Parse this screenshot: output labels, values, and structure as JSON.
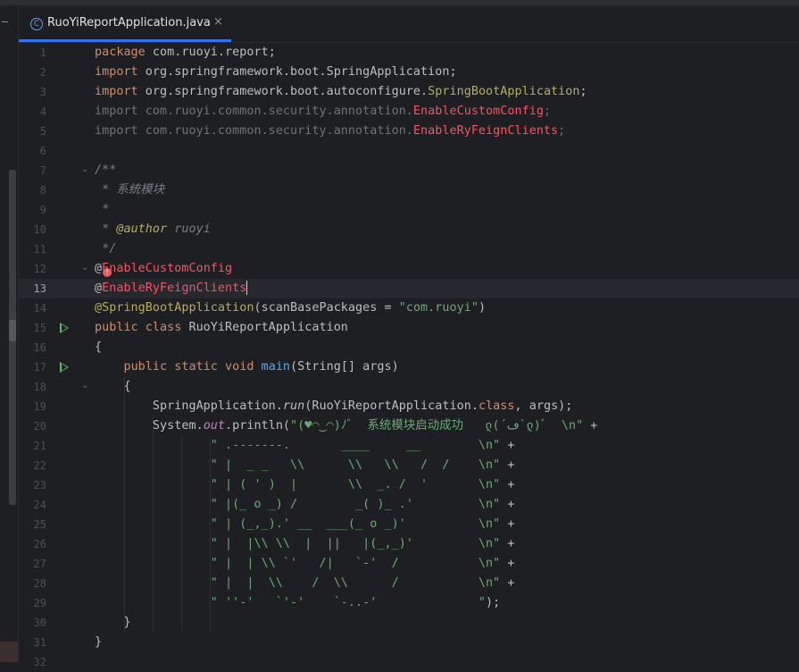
{
  "tab": {
    "icon_name": "java-class-icon",
    "icon_glyph": "C",
    "file_name": "RuoYiReportApplication.java",
    "close_glyph": "×"
  },
  "editor": {
    "current_line": 13,
    "line_numbers": [
      "1",
      "2",
      "3",
      "4",
      "5",
      "6",
      "7",
      "8",
      "9",
      "10",
      "11",
      "12",
      "13",
      "14",
      "15",
      "16",
      "17",
      "18",
      "19",
      "20",
      "21",
      "22",
      "23",
      "24",
      "25",
      "26",
      "27",
      "28",
      "29",
      "30",
      "31",
      "32"
    ]
  },
  "code": {
    "l1": {
      "kw": "package",
      "rest": " com.ruoyi.report;"
    },
    "l2": {
      "kw": "import",
      "rest": " org.springframework.boot.SpringApplication;"
    },
    "l3": {
      "kw": "import",
      "rest": " org.springframework.boot.autoconfigure.",
      "cls": "SpringBootApplication",
      "end": ";"
    },
    "l4": {
      "pre": "import com.ruoyi.common.security.annotation.",
      "err": "EnableCustomConfig",
      "end": ";"
    },
    "l5": {
      "pre": "import com.ruoyi.common.security.annotation.",
      "err": "EnableRyFeignClients",
      "end": ";"
    },
    "l7": "/**",
    "l8": " * 系统模块",
    "l9": " *",
    "l10": {
      "pre": " * ",
      "tag": "@author",
      "rest": " ruoyi"
    },
    "l11": " */",
    "l12": {
      "at": "@",
      "err": "EnableCustomConfig"
    },
    "l13": {
      "at": "@",
      "err": "EnableRyFeignClients"
    },
    "l14": {
      "ann": "@SpringBootApplication",
      "open": "(scanBasePackages = ",
      "str": "\"com.ruoyi\"",
      "close": ")"
    },
    "l15": {
      "kw": "public class",
      "rest": " RuoYiReportApplication"
    },
    "l16": "{",
    "l17": {
      "indent": "    ",
      "kw": "public static void",
      "sp": " ",
      "fn": "main",
      "rest": "(String[] args)"
    },
    "l18": "    {",
    "l19": {
      "indent": "        SpringApplication.",
      "stat": "run",
      "mid": "(RuoYiReportApplication.",
      "kw": "class",
      "rest": ", args);"
    },
    "l20": {
      "indent": "        System.",
      "stat": "out",
      "mid": ".println(",
      "str": "\"(♥◠‿◠)ﾉﾞ  系统模块启动成功   ლ(´ڡ`ლ)ﾞ  \\n\"",
      "rest": " +"
    },
    "l21": {
      "indent": "                ",
      "str": "\" .-------.       ____     __        \\n\"",
      "rest": " +"
    },
    "l22": {
      "indent": "                ",
      "str": "\" |  _ _   \\\\      \\\\   \\\\   /  /    \\n\"",
      "rest": " +"
    },
    "l23": {
      "indent": "                ",
      "str": "\" | ( ' )  |       \\\\  _. /  '       \\n\"",
      "rest": " +"
    },
    "l24": {
      "indent": "                ",
      "str": "\" |(_ o _) /        _( )_ .'         \\n\"",
      "rest": " +"
    },
    "l25": {
      "indent": "                ",
      "str": "\" | (_,_).' __  ___(_ o _)'          \\n\"",
      "rest": " +"
    },
    "l26": {
      "indent": "                ",
      "str": "\" |  |\\\\ \\\\  |  ||   |(_,_)'         \\n\"",
      "rest": " +"
    },
    "l27": {
      "indent": "                ",
      "str": "\" |  | \\\\ `'   /|   `-'  /           \\n\"",
      "rest": " +"
    },
    "l28": {
      "indent": "                ",
      "str": "\" |  |  \\\\    /  \\\\      /           \\n\"",
      "rest": " +"
    },
    "l29": {
      "indent": "                ",
      "str": "\" ''-'   `'-'    `-..-'              \"",
      "rest": ");"
    },
    "l30": "    }",
    "l31": "}"
  },
  "gutter": {
    "fold_glyph": "⌄",
    "error_badge_glyph": "!",
    "run_icon_name": "run-gutter-icon"
  }
}
